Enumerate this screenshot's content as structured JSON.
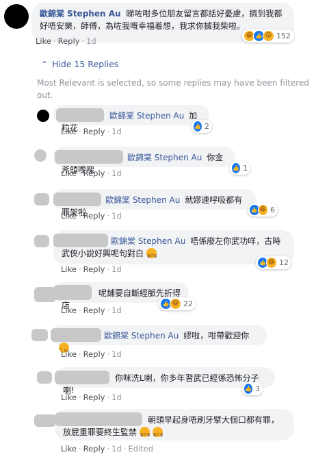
{
  "root": {
    "author": "歐錦棠 Stephen Au",
    "text_line1": "睇咗咁多位朋友留言都話好憂慮，搞到我都",
    "text_line2": "好唔安樂，師傅，為咗我嘅幸福着想，我求你搣我柴啦。",
    "reaction_count": "152",
    "like": "Like",
    "reply": "Reply",
    "time": "1d"
  },
  "hide_replies": "Hide 15 Replies",
  "filter_note_line1": "Most Relevant is selected, so some replies may have been filtered",
  "filter_note_line2": "out.",
  "replies": [
    {
      "mention": "歐錦棠 Stephen Au",
      "text": "加粒花",
      "count": "2",
      "like": "Like",
      "reply": "Reply",
      "time": "1d"
    },
    {
      "mention": "歐錦棠 Stephen Au",
      "text": "你金斧頭嚟㗎",
      "count": "1",
      "like": "Like",
      "reply": "Reply",
      "time": "1d"
    },
    {
      "mention": "歐錦棠 Stephen Au",
      "text": "就嫪連呼吸都有罪架啦",
      "count": "6",
      "like": "Like",
      "reply": "Reply",
      "time": "1d"
    },
    {
      "mention": "歐錦棠 Stephen Au",
      "text": "唔係廢左你武功咩，古時",
      "text2": "武俠小說好興呢句對白",
      "count": "12",
      "like": "Like",
      "reply": "Reply",
      "time": "1d"
    },
    {
      "text": "呢鋪要自斷經脈先折得店",
      "count": "22",
      "like": "Like",
      "reply": "Reply",
      "time": "1d"
    },
    {
      "mention": "歐錦棠 Stephen Au",
      "text": "嫪啦，咁帶歡迎你",
      "like": "Like",
      "reply": "Reply",
      "time": "1d"
    },
    {
      "text": "你咪洗L喇，你多年習武已經係恐怖分子喇!",
      "count": "3",
      "like": "Like",
      "reply": "Reply",
      "time": "1d"
    },
    {
      "text": "朝頭早起身唔刷牙擘大個口都有罪，",
      "text2": "放屁重罪要終生監禁",
      "like": "Like",
      "reply": "Reply",
      "time": "1d",
      "edited": "Edited"
    }
  ]
}
